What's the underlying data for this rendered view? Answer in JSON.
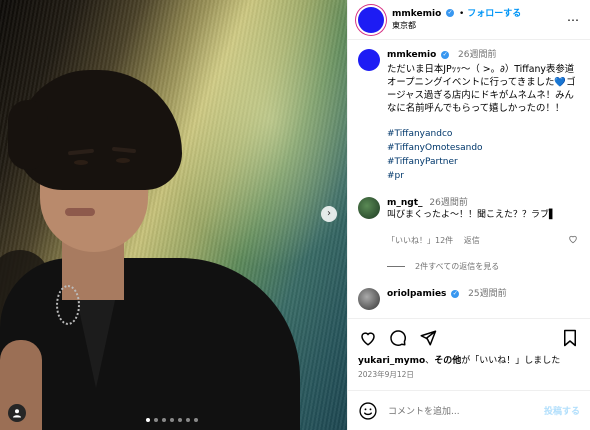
{
  "post": {
    "photo_alt": "",
    "carousel": {
      "count": 7,
      "active_index": 0
    }
  },
  "header": {
    "username": "mmkemio",
    "follow_separator": "•",
    "follow_label": "フォローする",
    "location": "東京都",
    "more_label": "⋯"
  },
  "caption": {
    "username": "mmkemio",
    "time": "26週間前",
    "text": "ただいま日本JPｯｯ〜（ >。∂）Tiffany表参道 オープニングイベントに行ってきました💙ゴージャス過ぎる店内にドキがムネムネ！みんなに名前呼んでもらって嬉しかったの！！",
    "hashtags": [
      "#Tiffanyandco",
      "#TiffanyOmotesando",
      "#TiffanyPartner",
      "#pr"
    ]
  },
  "comments": [
    {
      "username": "m_ngt_",
      "time": "26週間前",
      "text": "叫びまくったよ〜！！聞こえた？？ラブ▌",
      "likes_label": "「いいね！」12件",
      "reply_label": "返信",
      "view_replies": "2件すべての返信を見る"
    },
    {
      "username": "oriolpamies",
      "time": "25週間前"
    }
  ],
  "actions": {
    "likes_user": "yukari_mymo",
    "likes_connector": "、",
    "likes_others": "その他",
    "likes_suffix": "が「いいね！」しました",
    "date": "2023年9月12日"
  },
  "add_comment": {
    "placeholder": "コメントを追加...",
    "post_label": "投稿する"
  },
  "colors": {
    "avatar_blue": "#1d1cf4",
    "link_blue": "#0095f6",
    "hashtag": "#00376b",
    "muted": "#737373"
  }
}
